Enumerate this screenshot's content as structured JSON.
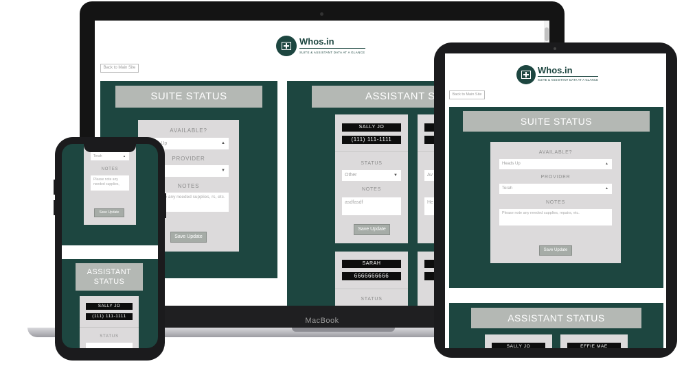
{
  "macbook": {
    "label": "MacBook"
  },
  "app": {
    "brand": "Whos.in",
    "tagline": "SUITE & ASSISTANT DATA AT A GLANCE",
    "back_link": "Back to Main Site",
    "suite_status": {
      "title": "SUITE STATUS",
      "available_label": "AVAILABLE?",
      "available_value": "Heads Up",
      "available_value_partial": "ds Up",
      "provider_label": "PROVIDER",
      "provider_value": "Terah",
      "notes_label": "NOTES",
      "notes_placeholder": "Please note any needed supplies, repairs, etc.",
      "notes_partial": "e note any needed supplies, rs, etc.",
      "notes_phone": "Please note any needed supplies,",
      "save_label": "Save Update"
    },
    "assistant_status": {
      "title": "ASSISTANT STATUS",
      "title_partial": "ASSISTANT ST",
      "title_line1": "ASSISTANT",
      "title_line2": "STATUS",
      "status_label": "STATUS",
      "notes_label": "NOTES",
      "save_label": "Save Update",
      "assistants": [
        {
          "name": "SALLY JO",
          "phone": "(111) 111-1111",
          "status": "Other",
          "notes": "asdfasdf"
        },
        {
          "name": "EFFIE MAE",
          "status_partial": "Av",
          "notes_partial": "He"
        },
        {
          "name": "SARAH",
          "phone": "6666666666"
        }
      ]
    }
  },
  "colors": {
    "panel_green": "#1d4640",
    "title_gray": "#b4b8b4",
    "card_gray": "#dcdadb",
    "device_dark": "#1b1b1d"
  },
  "icons": {
    "logo": "medical-cross-icon",
    "dropdown": "select-arrows-icon"
  }
}
